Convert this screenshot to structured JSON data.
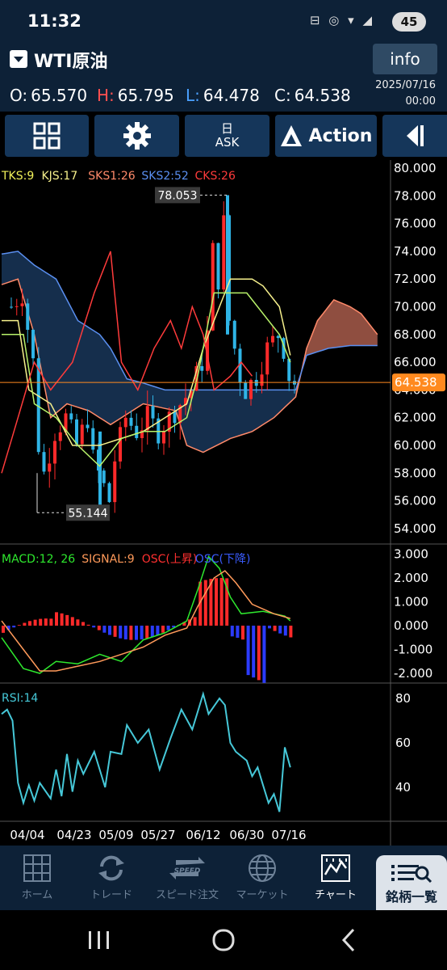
{
  "status": {
    "time": "11:32",
    "battery": "45"
  },
  "header": {
    "symbol": "WTI原油",
    "info_label": "info",
    "ohlc": {
      "o_label": "O:",
      "o": "65.570",
      "h_label": "H:",
      "h": "65.795",
      "l_label": "L:",
      "l": "64.478",
      "c_label": "C:",
      "c": "64.538"
    },
    "date": "2025/07/16",
    "time": "00:00"
  },
  "toolbar": {
    "ask_top": "日",
    "ask_label": "ASK",
    "action_label": "Action"
  },
  "chart": {
    "price_legend": [
      {
        "text": "TKS:9",
        "color": "#f2f25a"
      },
      {
        "text": "KJS:17",
        "color": "#f6f08c"
      },
      {
        "text": "SKS1:26",
        "color": "#ff8a6a"
      },
      {
        "text": "SKS2:52",
        "color": "#5a8ff0"
      },
      {
        "text": "CKS:26",
        "color": "#ff3b3b"
      }
    ],
    "price_ticks": [
      "80.000",
      "78.000",
      "76.000",
      "74.000",
      "72.000",
      "70.000",
      "68.000",
      "66.000",
      "64.000",
      "62.000",
      "60.000",
      "58.000",
      "56.000",
      "54.000"
    ],
    "high_label": "78.053",
    "low_label": "55.144",
    "current_price": "64.538",
    "macd_legend": [
      {
        "text": "MACD:12, 26",
        "color": "#2ee82e"
      },
      {
        "text": "SIGNAL:9",
        "color": "#ff9a5a"
      },
      {
        "text": "OSC(上昇)",
        "color": "#ff3030"
      },
      {
        "text": "OSC(下降)",
        "color": "#3a5cff"
      }
    ],
    "macd_ticks": [
      "3.000",
      "2.000",
      "1.000",
      "0.000",
      "-1.000",
      "-2.000"
    ],
    "rsi_label": "RSI:14",
    "rsi_ticks": [
      "80",
      "60",
      "40"
    ],
    "x_dates": [
      "04/04",
      "04/23",
      "05/09",
      "05/27",
      "06/12",
      "06/30",
      "07/16"
    ],
    "colors": {
      "up": "#ff2a2a",
      "down": "#2fb4e6",
      "tenkan": "#f2f25a",
      "kijun": "#f6f08c",
      "span1": "#ff8a6a",
      "span2": "#5a8ff0",
      "chikou": "#ff3b3b",
      "rsi": "#46c8d8",
      "price_badge": "#ff8a1f"
    }
  },
  "tabs": [
    {
      "label": "ホーム",
      "icon": "grid-icon"
    },
    {
      "label": "トレード",
      "icon": "swap-icon"
    },
    {
      "label": "スピード注文",
      "icon": "speed-icon"
    },
    {
      "label": "マーケット",
      "icon": "globe-icon"
    },
    {
      "label": "チャート",
      "icon": "chart-icon"
    },
    {
      "label": "銘柄一覧",
      "icon": "list-icon"
    }
  ]
}
